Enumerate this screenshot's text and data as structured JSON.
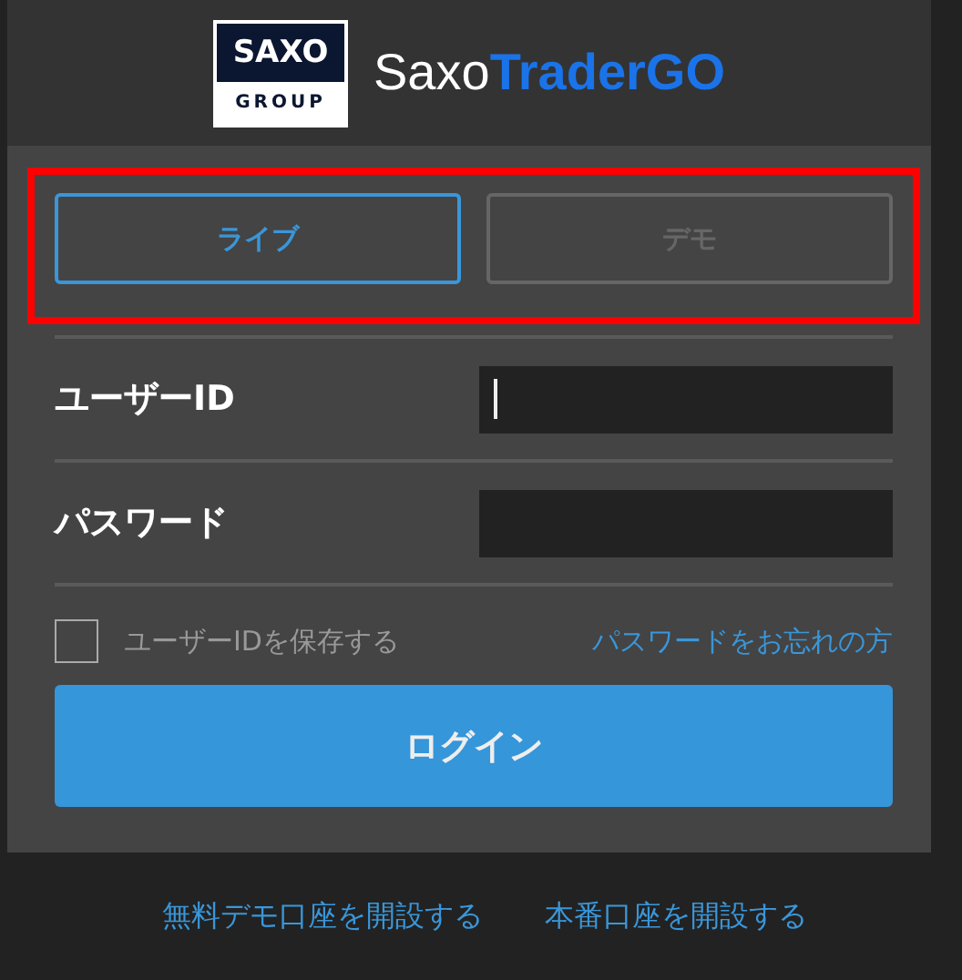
{
  "logo": {
    "top": "SAXO",
    "bottom": "GROUP"
  },
  "brand": {
    "plain": "Saxo",
    "accent": "TraderGO"
  },
  "tabs": [
    {
      "label": "ライブ",
      "selected": true
    },
    {
      "label": "デモ",
      "selected": false
    }
  ],
  "tabs_highlighted": true,
  "fields": [
    {
      "label": "ユーザーID",
      "focused": true
    },
    {
      "label": "パスワード",
      "focused": false
    }
  ],
  "remember": {
    "label": "ユーザーIDを保存する",
    "checked": false
  },
  "forgot_link": "パスワードをお忘れの方",
  "login_button": "ログイン",
  "footer_links": [
    "無料デモ口座を開設する",
    "本番口座を開設する"
  ]
}
